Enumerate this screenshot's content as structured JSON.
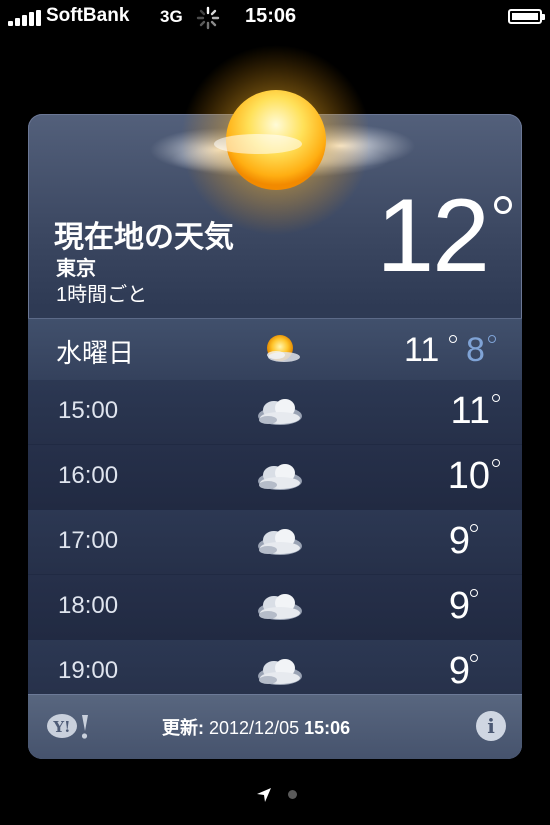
{
  "status_bar": {
    "carrier": "SoftBank",
    "network": "3G",
    "time": "15:06"
  },
  "weather": {
    "location_title": "現在地の天気",
    "city": "東京",
    "mode": "1時間ごと",
    "current_temp": "12",
    "day": {
      "name": "水曜日",
      "high": "11",
      "low": "8"
    },
    "hourly": [
      {
        "time": "15:00",
        "temp": "11"
      },
      {
        "time": "16:00",
        "temp": "10"
      },
      {
        "time": "17:00",
        "temp": "9"
      },
      {
        "time": "18:00",
        "temp": "9"
      },
      {
        "time": "19:00",
        "temp": "9"
      }
    ]
  },
  "footer": {
    "updated_label": "更新:",
    "updated_date": "2012/12/05",
    "updated_time": "15:06",
    "yahoo_logo": "Y!",
    "info_icon": "i"
  },
  "colors": {
    "low_temp": "#7fa3d6",
    "card_top": "#53607b",
    "card_bottom": "#2a3550"
  }
}
